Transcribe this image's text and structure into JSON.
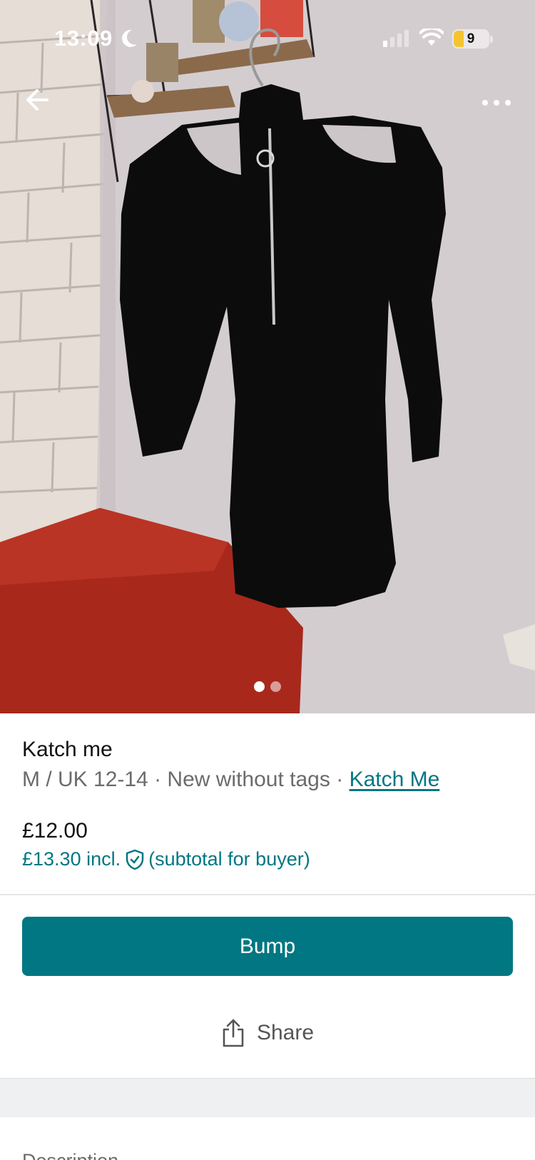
{
  "status_bar": {
    "time": "13:09",
    "battery_level": "9",
    "icons": [
      "moon-icon",
      "signal-icon",
      "wifi-icon",
      "battery-icon"
    ]
  },
  "top_bar": {
    "back_icon": "arrow-left-icon",
    "more_icon": "more-horizontal-icon"
  },
  "photo": {
    "total_images": 2,
    "active_index": 0
  },
  "item": {
    "title": "Katch me",
    "size": "M / UK 12-14",
    "condition": "New without tags",
    "separator": "·",
    "brand": "Katch Me",
    "price": "£12.00",
    "buyer_price": "£13.30 incl.",
    "buyer_note": "(subtotal for buyer)"
  },
  "actions": {
    "bump_label": "Bump",
    "share_label": "Share",
    "share_icon": "share-icon"
  },
  "section": {
    "description_label": "Description"
  },
  "colors": {
    "accent": "#007782",
    "muted_text": "#6b6b6b",
    "band": "#eef0f1"
  }
}
